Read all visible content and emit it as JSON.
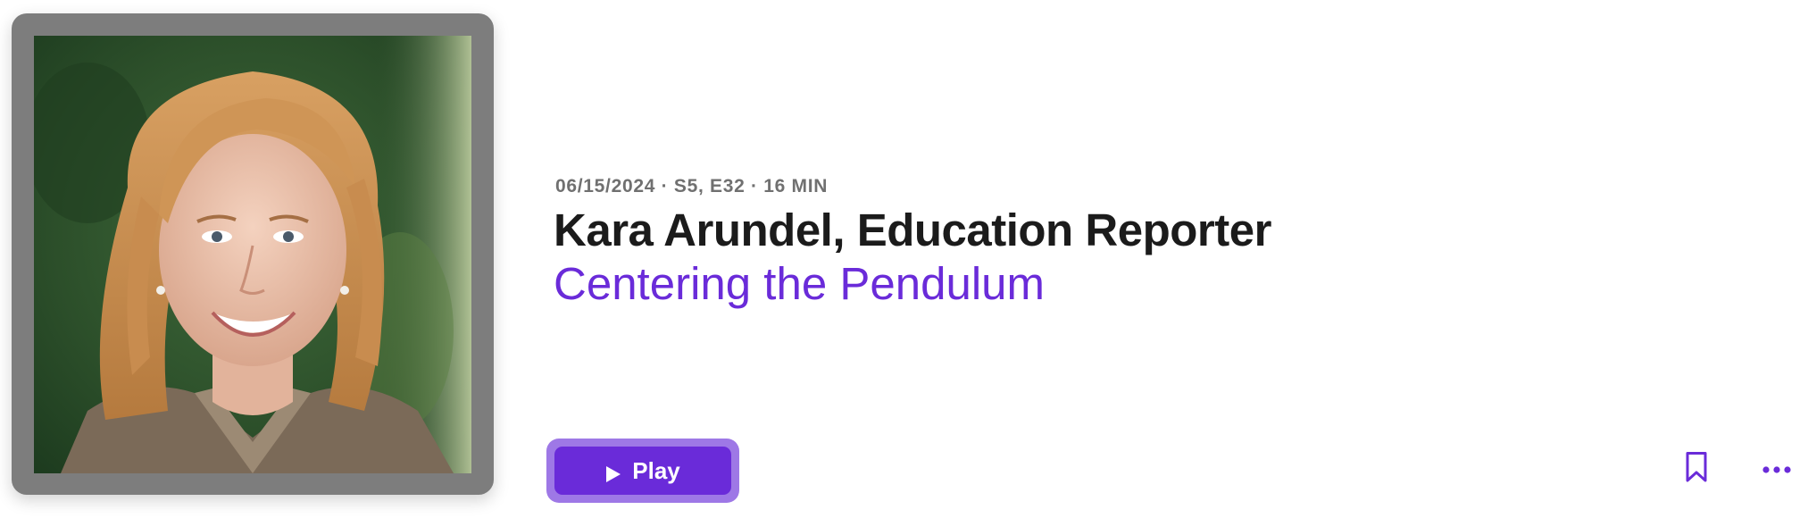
{
  "episode": {
    "meta": "06/15/2024 · S5, E32 · 16 MIN",
    "title": "Kara Arundel, Education Reporter",
    "show_name": "Centering the Pendulum",
    "artwork_icon": "episode-artwork-portrait"
  },
  "actions": {
    "play_label": "Play",
    "play_icon": "play-icon",
    "bookmark_icon": "bookmark-icon",
    "more_icon": "more-dots-icon"
  },
  "colors": {
    "accent": "#6a2bd9",
    "accent_focus_ring": "#9e78e6",
    "meta_text": "#707070",
    "title_text": "#1b1b1b",
    "artwork_frame": "#7d7d7d"
  }
}
